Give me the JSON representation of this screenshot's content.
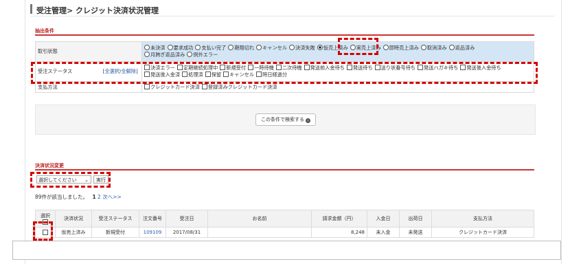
{
  "page": {
    "title": "受注管理> クレジット決済状況管理"
  },
  "filter": {
    "section_label": "抽出条件",
    "status_row": {
      "label": "取引状態",
      "options_line1": [
        "未決済",
        "要求成功",
        "支払い完了",
        "期限切れ",
        "キャンセル",
        "決済失敗",
        "仮売上済み",
        "実売上済み",
        "即時売上済み",
        "取消済み",
        "返品済み"
      ],
      "options_line2": [
        "月跨ぎ返品済み",
        "例外エラー"
      ],
      "selected": "仮売上済み"
    },
    "order_status_row": {
      "label": "受注ステータス",
      "select_all": "全選択",
      "clear_all": "全解除",
      "options_line1": [
        "決済エラー",
        "定期継続処理中",
        "新規受付",
        "一時待機",
        "二次待機",
        "発送前入金待ち",
        "発送待ち",
        "送り状番号待ち",
        "発送ハガキ待ち",
        "発送後入金待ち"
      ],
      "options_line2": [
        "発送後入金済",
        "処理済",
        "保留",
        "キャンセル",
        "時日経過分"
      ]
    },
    "payment_row": {
      "label": "支払方法",
      "options": [
        "クレジットカード決済",
        "登録済みクレジットカード決済"
      ]
    },
    "search_button": "この条件で検索する"
  },
  "bulk": {
    "section_label": "決済状況変更",
    "select_placeholder": "選択してください",
    "execute_label": "実行"
  },
  "results": {
    "count_text": "89件が該当しました。",
    "pages": [
      "1",
      "2",
      "次へ>>"
    ],
    "headers": [
      "選択",
      "決済状況",
      "受注ステータス",
      "注文番号",
      "受注日",
      "お名前",
      "請求金額（円）",
      "入金日",
      "出荷日",
      "支払方法"
    ],
    "rows": [
      {
        "status": "仮売上済み",
        "order_status": "新規受付",
        "order_no": "109109",
        "date": "2017/08/31",
        "name": "",
        "amount": "8,248",
        "paid": "未入金",
        "shipped": "未発送",
        "method": "クレジットカード決済"
      }
    ]
  }
}
